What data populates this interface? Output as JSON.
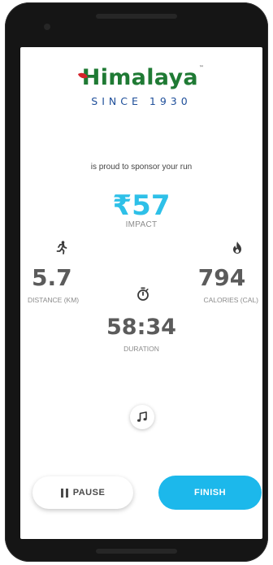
{
  "brand": {
    "name": "Himalaya",
    "trademark": "™",
    "tagline": "SINCE 1930",
    "sponsor_text": "is proud to sponsor your run"
  },
  "impact": {
    "value": "₹57",
    "label": "IMPACT"
  },
  "stats": {
    "distance": {
      "value": "5.7",
      "label": "DISTANCE (KM)",
      "icon": "running-person-icon"
    },
    "calories": {
      "value": "794",
      "label": "CALORIES (CAL)",
      "icon": "flame-icon"
    },
    "duration": {
      "value": "58:34",
      "label": "DURATION",
      "icon": "stopwatch-icon"
    }
  },
  "controls": {
    "music_icon": "music-note-icon",
    "pause_label": "PAUSE",
    "finish_label": "FINISH"
  },
  "colors": {
    "accent": "#1cb8eb",
    "impact": "#2ec0e8",
    "brand_green": "#1f7a34",
    "brand_blue": "#1f4f9a",
    "leaf_red": "#d4232b",
    "stat_text": "#5b5b5b"
  }
}
